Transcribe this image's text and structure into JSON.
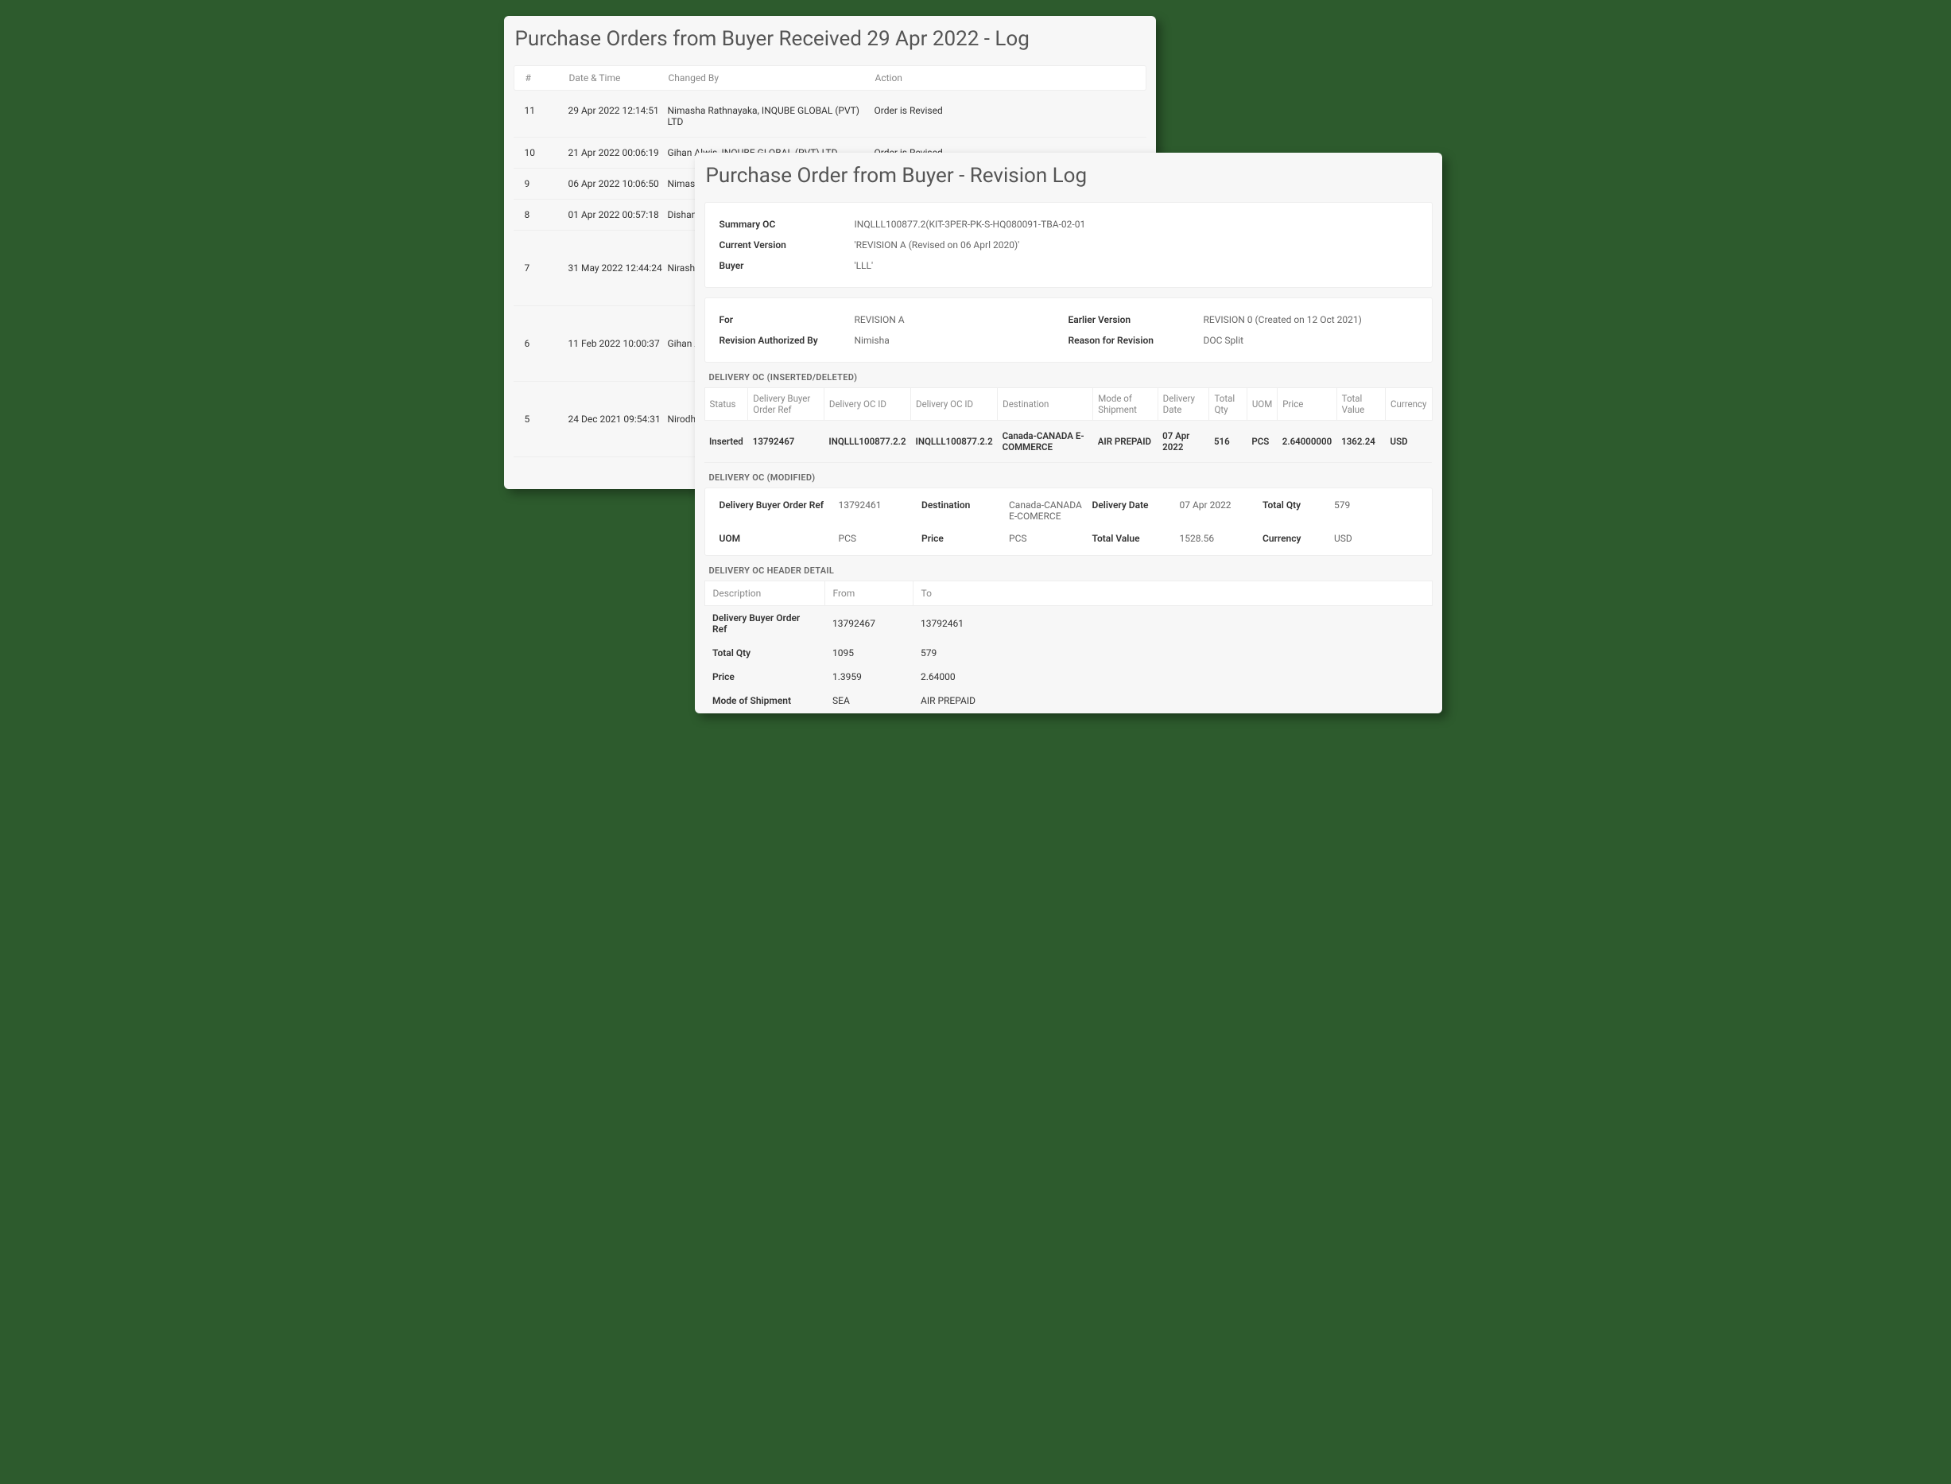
{
  "back": {
    "title": "Purchase Orders  from Buyer  Received 29 Apr 2022 - Log",
    "columns": {
      "num": "#",
      "datetime": "Date & Time",
      "changedBy": "Changed By",
      "action": "Action"
    },
    "rows": [
      {
        "num": "11",
        "datetime": "29 Apr 2022 12:14:51",
        "by": "Nimasha Rathnayaka, INQUBE GLOBAL  (PVT) LTD",
        "action": "Order is Revised",
        "tall": false
      },
      {
        "num": "10",
        "datetime": "21 Apr 2022 00:06:19",
        "by": "Gihan Alwis, INQUBE GLOBAL  (PVT) LTD",
        "action": "Order is Revised",
        "tall": false
      },
      {
        "num": "9",
        "datetime": "06 Apr 2022 10:06:50",
        "by": "Nimasha",
        "action": "",
        "tall": false
      },
      {
        "num": "8",
        "datetime": "01 Apr 2022 00:57:18",
        "by": "Dishan T",
        "action": "",
        "tall": false
      },
      {
        "num": "7",
        "datetime": "31 May 2022 12:44:24",
        "by": "Nirasha",
        "action": "",
        "tall": true
      },
      {
        "num": "6",
        "datetime": "11 Feb 2022 10:00:37",
        "by": "Gihan Alv",
        "action": "",
        "tall": true
      },
      {
        "num": "5",
        "datetime": "24 Dec 2021 09:54:31",
        "by": "Nirodha",
        "action": "",
        "tall": true
      }
    ]
  },
  "front": {
    "title": "Purchase Order from Buyer - Revision Log",
    "summary": {
      "labels": {
        "summaryOC": "Summary OC",
        "currentVersion": "Current Version",
        "buyer": "Buyer"
      },
      "summaryOC": "INQLLL100877.2(KIT-3PER-PK-S-HQ080091-TBA-02-01",
      "currentVersion": "'REVISION A (Revised on 06 Aprl 2020)'",
      "buyer": "'LLL'"
    },
    "revision": {
      "labels": {
        "for": "For",
        "earlierVersion": "Earlier Version",
        "authorizedBy": "Revision Authorized By",
        "reason": "Reason for Revision"
      },
      "for": "REVISION A",
      "earlierVersion": "REVISION 0 (Created on 12 Oct 2021)",
      "authorizedBy": "Nimisha",
      "reason": "DOC Split"
    },
    "inserted": {
      "sectionTitle": "DELIVERY OC (INSERTED/DELETED)",
      "columns": {
        "status": "Status",
        "buyerRef": "Delivery Buyer Order Ref",
        "ocid1": "Delivery OC ID",
        "ocid2": "Delivery OC ID",
        "destination": "Destination",
        "mode": "Mode of Shipment",
        "deliveryDate": "Delivery Date",
        "totalQty": "Total Qty",
        "uom": "UOM",
        "price": "Price",
        "totalValue": "Total Value",
        "currency": "Currency"
      },
      "row": {
        "status": "Inserted",
        "buyerRef": "13792467",
        "ocid1": "INQLLL100877.2.2",
        "ocid2": "INQLLL100877.2.2",
        "destination": "Canada-CANADA E-COMMERCE",
        "mode": "AIR PREPAID",
        "deliveryDate": "07 Apr 2022",
        "totalQty": "516",
        "uom": "PCS",
        "price": "2.64000000",
        "totalValue": "1362.24",
        "currency": "USD"
      }
    },
    "modified": {
      "sectionTitle": "DELIVERY OC (MODIFIED)",
      "labels": {
        "buyerRef": "Delivery  Buyer Order Ref",
        "destination": "Destination",
        "deliveryDate": "Delivery Date",
        "totalQty": "Total Qty",
        "uom": "UOM",
        "price": "Price",
        "totalValue": "Total Value",
        "currency": "Currency"
      },
      "values": {
        "buyerRef": "13792461",
        "destination": "Canada-CANADA E-COMERCE",
        "deliveryDate": "07 Apr 2022",
        "totalQty": "579",
        "uom": "PCS",
        "price": "PCS",
        "totalValue": "1528.56",
        "currency": "USD"
      }
    },
    "headerDetail": {
      "sectionTitle": "DELIVERY OC HEADER DETAIL",
      "columns": {
        "desc": "Description",
        "from": "From",
        "to": "To"
      },
      "rows": [
        {
          "desc": "Delivery Buyer Order Ref",
          "from": "13792467",
          "to": "13792461"
        },
        {
          "desc": "Total Qty",
          "from": "1095",
          "to": "579"
        },
        {
          "desc": "Price",
          "from": "1.3959",
          "to": "2.64000"
        },
        {
          "desc": "Mode of Shipment",
          "from": "SEA",
          "to": "AIR PREPAID"
        }
      ]
    }
  }
}
